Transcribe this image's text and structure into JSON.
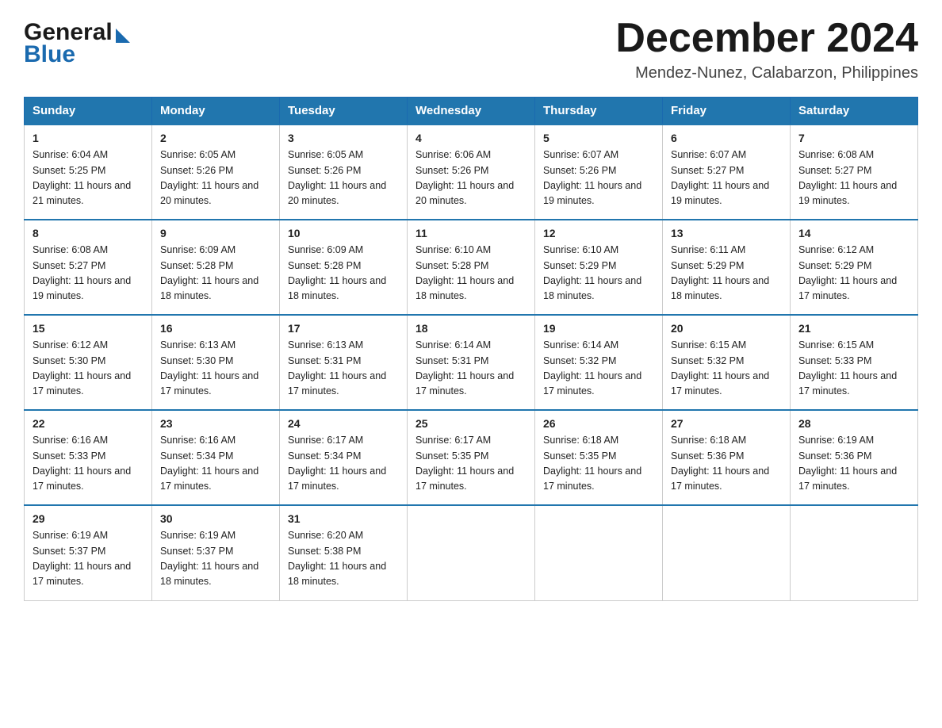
{
  "header": {
    "logo_general": "General",
    "logo_blue": "Blue",
    "month_title": "December 2024",
    "location": "Mendez-Nunez, Calabarzon, Philippines"
  },
  "days_of_week": [
    "Sunday",
    "Monday",
    "Tuesday",
    "Wednesday",
    "Thursday",
    "Friday",
    "Saturday"
  ],
  "weeks": [
    [
      {
        "day": "1",
        "sunrise": "6:04 AM",
        "sunset": "5:25 PM",
        "daylight": "11 hours and 21 minutes."
      },
      {
        "day": "2",
        "sunrise": "6:05 AM",
        "sunset": "5:26 PM",
        "daylight": "11 hours and 20 minutes."
      },
      {
        "day": "3",
        "sunrise": "6:05 AM",
        "sunset": "5:26 PM",
        "daylight": "11 hours and 20 minutes."
      },
      {
        "day": "4",
        "sunrise": "6:06 AM",
        "sunset": "5:26 PM",
        "daylight": "11 hours and 20 minutes."
      },
      {
        "day": "5",
        "sunrise": "6:07 AM",
        "sunset": "5:26 PM",
        "daylight": "11 hours and 19 minutes."
      },
      {
        "day": "6",
        "sunrise": "6:07 AM",
        "sunset": "5:27 PM",
        "daylight": "11 hours and 19 minutes."
      },
      {
        "day": "7",
        "sunrise": "6:08 AM",
        "sunset": "5:27 PM",
        "daylight": "11 hours and 19 minutes."
      }
    ],
    [
      {
        "day": "8",
        "sunrise": "6:08 AM",
        "sunset": "5:27 PM",
        "daylight": "11 hours and 19 minutes."
      },
      {
        "day": "9",
        "sunrise": "6:09 AM",
        "sunset": "5:28 PM",
        "daylight": "11 hours and 18 minutes."
      },
      {
        "day": "10",
        "sunrise": "6:09 AM",
        "sunset": "5:28 PM",
        "daylight": "11 hours and 18 minutes."
      },
      {
        "day": "11",
        "sunrise": "6:10 AM",
        "sunset": "5:28 PM",
        "daylight": "11 hours and 18 minutes."
      },
      {
        "day": "12",
        "sunrise": "6:10 AM",
        "sunset": "5:29 PM",
        "daylight": "11 hours and 18 minutes."
      },
      {
        "day": "13",
        "sunrise": "6:11 AM",
        "sunset": "5:29 PM",
        "daylight": "11 hours and 18 minutes."
      },
      {
        "day": "14",
        "sunrise": "6:12 AM",
        "sunset": "5:29 PM",
        "daylight": "11 hours and 17 minutes."
      }
    ],
    [
      {
        "day": "15",
        "sunrise": "6:12 AM",
        "sunset": "5:30 PM",
        "daylight": "11 hours and 17 minutes."
      },
      {
        "day": "16",
        "sunrise": "6:13 AM",
        "sunset": "5:30 PM",
        "daylight": "11 hours and 17 minutes."
      },
      {
        "day": "17",
        "sunrise": "6:13 AM",
        "sunset": "5:31 PM",
        "daylight": "11 hours and 17 minutes."
      },
      {
        "day": "18",
        "sunrise": "6:14 AM",
        "sunset": "5:31 PM",
        "daylight": "11 hours and 17 minutes."
      },
      {
        "day": "19",
        "sunrise": "6:14 AM",
        "sunset": "5:32 PM",
        "daylight": "11 hours and 17 minutes."
      },
      {
        "day": "20",
        "sunrise": "6:15 AM",
        "sunset": "5:32 PM",
        "daylight": "11 hours and 17 minutes."
      },
      {
        "day": "21",
        "sunrise": "6:15 AM",
        "sunset": "5:33 PM",
        "daylight": "11 hours and 17 minutes."
      }
    ],
    [
      {
        "day": "22",
        "sunrise": "6:16 AM",
        "sunset": "5:33 PM",
        "daylight": "11 hours and 17 minutes."
      },
      {
        "day": "23",
        "sunrise": "6:16 AM",
        "sunset": "5:34 PM",
        "daylight": "11 hours and 17 minutes."
      },
      {
        "day": "24",
        "sunrise": "6:17 AM",
        "sunset": "5:34 PM",
        "daylight": "11 hours and 17 minutes."
      },
      {
        "day": "25",
        "sunrise": "6:17 AM",
        "sunset": "5:35 PM",
        "daylight": "11 hours and 17 minutes."
      },
      {
        "day": "26",
        "sunrise": "6:18 AM",
        "sunset": "5:35 PM",
        "daylight": "11 hours and 17 minutes."
      },
      {
        "day": "27",
        "sunrise": "6:18 AM",
        "sunset": "5:36 PM",
        "daylight": "11 hours and 17 minutes."
      },
      {
        "day": "28",
        "sunrise": "6:19 AM",
        "sunset": "5:36 PM",
        "daylight": "11 hours and 17 minutes."
      }
    ],
    [
      {
        "day": "29",
        "sunrise": "6:19 AM",
        "sunset": "5:37 PM",
        "daylight": "11 hours and 17 minutes."
      },
      {
        "day": "30",
        "sunrise": "6:19 AM",
        "sunset": "5:37 PM",
        "daylight": "11 hours and 18 minutes."
      },
      {
        "day": "31",
        "sunrise": "6:20 AM",
        "sunset": "5:38 PM",
        "daylight": "11 hours and 18 minutes."
      },
      null,
      null,
      null,
      null
    ]
  ],
  "sunrise_label": "Sunrise:",
  "sunset_label": "Sunset:",
  "daylight_label": "Daylight:"
}
